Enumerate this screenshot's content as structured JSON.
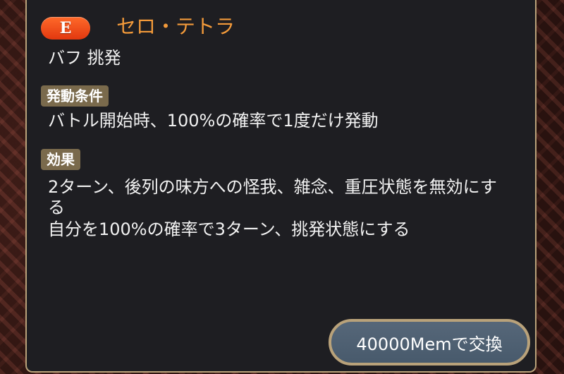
{
  "skill": {
    "rank": "E",
    "name": "セロ・テトラ",
    "tags": "バフ 挑発"
  },
  "conditions": {
    "label": "発動条件",
    "text": "バトル開始時、100%の確率で1度だけ発動"
  },
  "effects": {
    "label": "効果",
    "lines": [
      "2ターン、後列の味方への怪我、雑念、重圧状態を無効にす",
      "る",
      " 自分を100%の確率で3ターン、挑発状態にする"
    ]
  },
  "exchange_button": {
    "label": "40000Memで交換"
  },
  "colors": {
    "panel_bg": "#1e1e22",
    "panel_border": "#b9a27a",
    "rank_badge": "#ff5a1f",
    "skill_name": "#f39a3a",
    "section_label_bg": "#7a6a4c",
    "button_bg": "#4f6174"
  }
}
